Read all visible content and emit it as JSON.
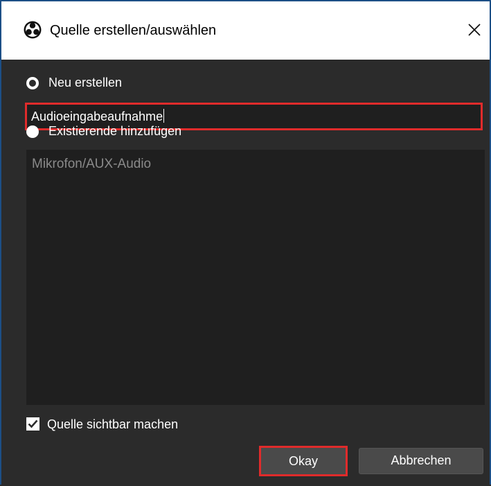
{
  "window": {
    "title": "Quelle erstellen/auswählen",
    "app_icon": "obs-logo-icon",
    "close_icon": "close-icon"
  },
  "create_new": {
    "label": "Neu erstellen",
    "selected": true,
    "input_value": "Audioeingabeaufnahme"
  },
  "add_existing": {
    "label": "Existierende hinzufügen",
    "selected": false,
    "items": [
      "Mikrofon/AUX-Audio"
    ]
  },
  "visibility": {
    "label": "Quelle sichtbar machen",
    "checked": true
  },
  "buttons": {
    "okay": "Okay",
    "cancel": "Abbrechen"
  },
  "colors": {
    "background": "#2b2b2b",
    "field_background": "#1f1f1f",
    "highlight": "#e02b2b",
    "button": "#4a4a4a"
  }
}
